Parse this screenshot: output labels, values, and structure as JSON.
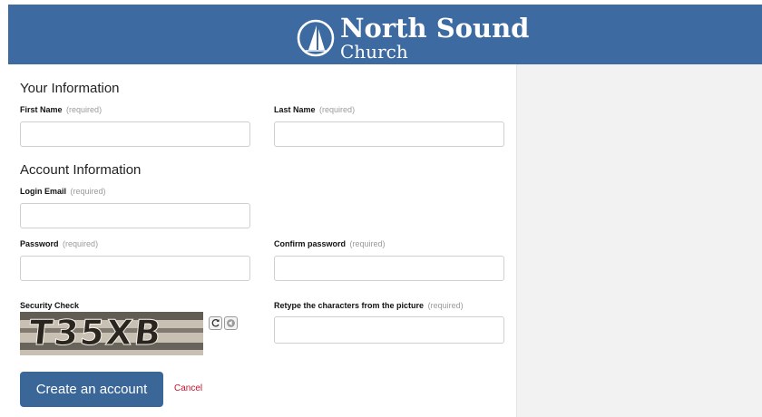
{
  "header": {
    "brand_line1": "North Sound",
    "brand_line2": "Church",
    "background_color": "#3d6aa0"
  },
  "form": {
    "your_information": {
      "title": "Your Information",
      "first_name_label": "First Name",
      "last_name_label": "Last Name",
      "required_text": "(required)",
      "first_name_value": "",
      "last_name_value": ""
    },
    "account_information": {
      "title": "Account Information",
      "login_email_label": "Login Email",
      "password_label": "Password",
      "confirm_password_label": "Confirm password",
      "required_text": "(required)",
      "login_email_value": "",
      "password_value": "",
      "confirm_password_value": ""
    },
    "security": {
      "label": "Security Check",
      "captcha_text": "T35XB",
      "retype_label": "Retype the characters from the picture",
      "retype_required": "(required)",
      "retype_value": "",
      "refresh_icon": "refresh-icon",
      "audio_icon": "audio-icon"
    },
    "actions": {
      "submit_label": "Create an account",
      "cancel_label": "Cancel",
      "submit_color": "#3a6698",
      "cancel_color": "#c8102e"
    }
  }
}
